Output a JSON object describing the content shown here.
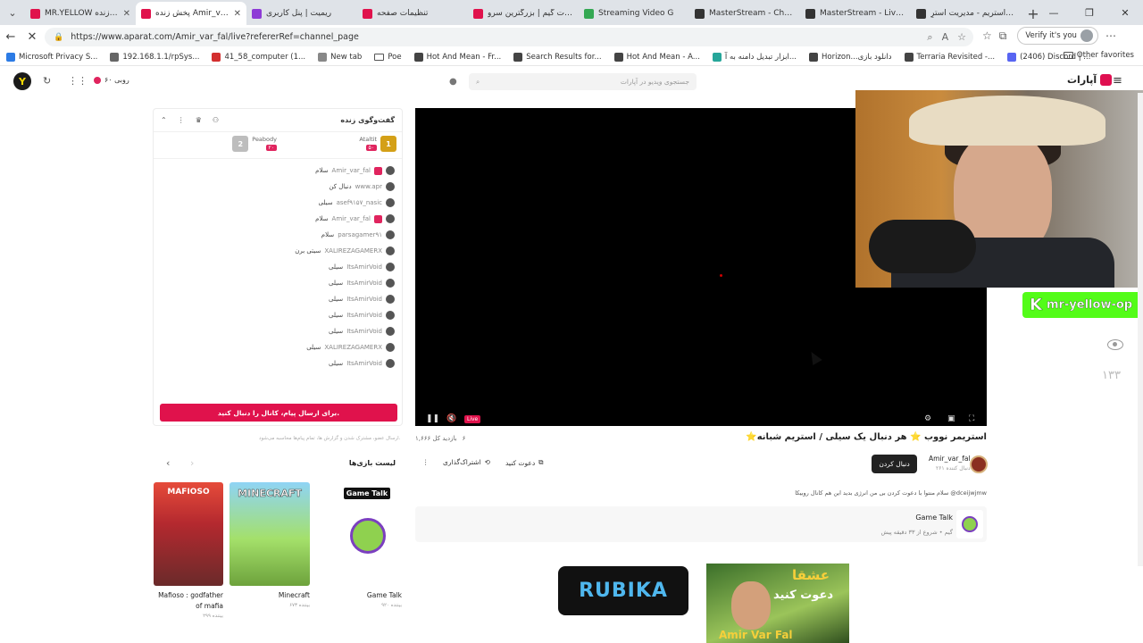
{
  "browser": {
    "tabs": [
      {
        "title": "MR.YELLOW پخش زنده",
        "color": "#e0124c",
        "active": false
      },
      {
        "title": "پخش زنده Amir_var_fal",
        "color": "#e0124c",
        "active": true
      },
      {
        "title": "ریمیت | پنل کاربری",
        "color": "#8e3bd6",
        "active": false
      },
      {
        "title": "تنظیمات صفحه",
        "color": "#e0124c",
        "active": false
      },
      {
        "title": "آپارات گیم | بزرگترین سرو",
        "color": "#e0124c",
        "active": false
      },
      {
        "title": "Streaming Video G",
        "color": "#34a853",
        "active": false
      },
      {
        "title": "MasterStream - Chat To",
        "color": "#333333",
        "active": false
      },
      {
        "title": "MasterStream - Live Vie",
        "color": "#333333",
        "active": false
      },
      {
        "title": "مسترآستریم - مدیریت استرِ",
        "color": "#333333",
        "active": false
      }
    ],
    "url": "https://www.aparat.com/Amir_var_fal/live?refererRef=channel_page",
    "verify_label": "Verify it's you",
    "bookmarks": [
      "Microsoft Privacy S...",
      "192.168.1.1/rpSys...",
      "41_58_computer (1...",
      "New tab",
      "Poe",
      "Hot And Mean - Fr...",
      "Search Results for...",
      "Hot And Mean - A...",
      "ابزار تبدیل دامنه به آ...",
      "Horizon...دانلود بازی",
      "Terraria Revisited -...",
      "(2406) Discord | ..."
    ],
    "other_favorites": "Other favorites"
  },
  "site": {
    "brand": "آپارات",
    "search_placeholder": "جستجوی ویدیو در آپارات",
    "coins": "۶۰ روبی"
  },
  "chat": {
    "title": "گفت‌وگوی زنده",
    "donors": [
      {
        "rank": "1",
        "name": "Ataltit",
        "amount": "۵۰",
        "color": "#d4a017"
      },
      {
        "rank": "2",
        "name": "Peabody",
        "amount": "۲۰",
        "color": "#bdbdbd"
      }
    ],
    "messages": [
      {
        "user": "Amir_var_fal",
        "text": "سلام",
        "badge": true
      },
      {
        "user": "www.apr",
        "text": "دنبال کن",
        "badge": false
      },
      {
        "user": "asef۹۱۵۷_nasic",
        "text": "سیلی",
        "badge": false
      },
      {
        "user": "Amir_var_fal",
        "text": "سلام",
        "badge": true
      },
      {
        "user": "parsagamer۹۱",
        "text": "سلام",
        "badge": false
      },
      {
        "user": "XALIREZAGAMERX",
        "text": "سیتی برن",
        "badge": false
      },
      {
        "user": "ItsAmirVoid",
        "text": "سیلی",
        "badge": false
      },
      {
        "user": "ItsAmirVoid",
        "text": "سیلی",
        "badge": false
      },
      {
        "user": "ItsAmirVoid",
        "text": "سیلی",
        "badge": false
      },
      {
        "user": "ItsAmirVoid",
        "text": "سیلی",
        "badge": false
      },
      {
        "user": "ItsAmirVoid",
        "text": "سیلی",
        "badge": false
      },
      {
        "user": "XALIREZAGAMERX",
        "text": "سیلی",
        "badge": false
      },
      {
        "user": "ItsAmirVoid",
        "text": "سیلی",
        "badge": false
      }
    ],
    "follow_button": "برای ارسال پیام، کانال را دنبال کنید.",
    "note": "ارسال عضو، مشترک شدن و گزارش ها، تمام پیام‌ها محاسبه می‌شود."
  },
  "video": {
    "live_label": "Live",
    "overlay_brand": "mr-yellow-op",
    "viewer_count": "۱۳۳"
  },
  "stream": {
    "title": "⭐استریمر نووب ⭐ هر دنبال یک سیلی / استریم شبانه",
    "views": "۱,۶۶۶ بازدید کل",
    "time": "۶",
    "channel_name": "Amir_var_fal",
    "channel_subs": "۲۶۱ دنبال کننده",
    "subscribe_label": "دنبال کردن",
    "invite_label": "دعوت کنید",
    "share_label": "اشتراک‌گذاری",
    "description": "سلام منتوا با دعوت کردن بی من انرژی بدید این هم کانال روبیکا @dceijwjmw",
    "category_name": "Game Talk",
    "category_meta": "گیم • شروع از ۳۳ دقیقه پیش"
  },
  "games": {
    "title": "لیست بازی‌ها",
    "items": [
      {
        "name": "Game Talk",
        "views": "۹۲۰ بیننده",
        "label": "Game Talk"
      },
      {
        "name": "Minecraft",
        "views": "۶۷۳ بیننده",
        "label": "MINECRAFT"
      },
      {
        "name": "Mafioso : godfather of mafia",
        "views": "۲۹۹ بیننده",
        "label": "MAFIOSO"
      }
    ]
  },
  "ads": {
    "rubika": "RUBIKA",
    "ad2_top": "عشقا",
    "ad2_mid": "دعوت کنید",
    "ad2_bottom": "Amir Var Fal"
  }
}
